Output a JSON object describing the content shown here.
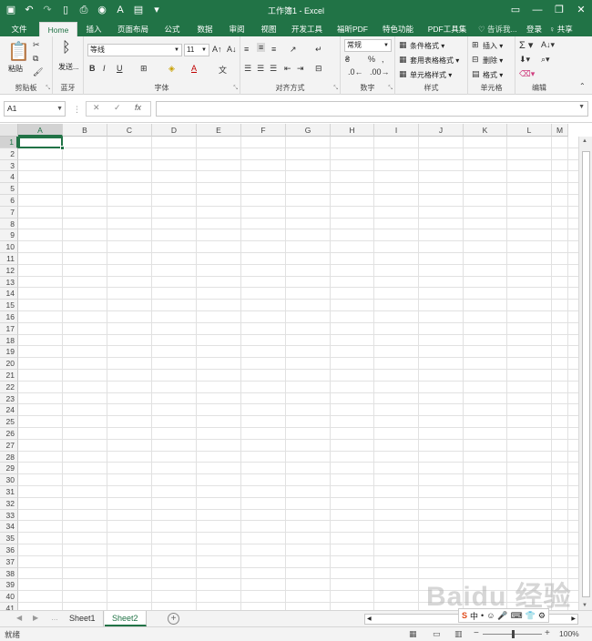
{
  "title_bar": {
    "title": "工作簿1 - Excel",
    "qat_icons": [
      "save-icon",
      "undo-icon",
      "redo-icon",
      "new-file-icon",
      "print-preview-icon",
      "camera-icon",
      "font-color-icon",
      "paste-dropdown-icon",
      "customize-qat-icon"
    ],
    "window_controls": [
      "ribbon-display-icon",
      "minimize-icon",
      "restore-icon",
      "close-icon"
    ]
  },
  "tabs": [
    "文件",
    "Home",
    "插入",
    "页面布局",
    "公式",
    "数据",
    "审阅",
    "视图",
    "开发工具",
    "福昕PDF",
    "特色功能",
    "PDF工具集"
  ],
  "active_tab": "Home",
  "tell_me": "♡ 告诉我...",
  "login": "登录",
  "share": "♀ 共享",
  "ribbon": {
    "clipboard": {
      "label": "剪贴板",
      "paste": "粘贴"
    },
    "bluetooth": {
      "label": "蓝牙",
      "send": "发送..."
    },
    "font": {
      "label": "字体",
      "font_name": "等线",
      "font_size": "11",
      "bold": "B",
      "italic": "I",
      "underline": "U"
    },
    "alignment": {
      "label": "对齐方式"
    },
    "number": {
      "label": "数字",
      "format": "常规",
      "percent": "%",
      "comma": ","
    },
    "styles": {
      "label": "样式",
      "conditional": "条件格式 ▾",
      "table": "套用表格格式 ▾",
      "cell_styles": "单元格样式 ▾"
    },
    "cells": {
      "label": "单元格",
      "insert": "插入 ▾",
      "delete": "删除 ▾",
      "format": "格式 ▾"
    },
    "editing": {
      "label": "编辑"
    }
  },
  "formula_bar": {
    "name_box": "A1",
    "fx": "fx",
    "value": ""
  },
  "grid": {
    "columns": [
      "A",
      "B",
      "C",
      "D",
      "E",
      "F",
      "G",
      "H",
      "I",
      "J",
      "K",
      "L",
      "M"
    ],
    "rows": [
      "1",
      "2",
      "3",
      "4",
      "5",
      "6",
      "7",
      "8",
      "9",
      "10",
      "11",
      "12",
      "13",
      "14",
      "15",
      "16",
      "17",
      "18",
      "19",
      "20",
      "21",
      "22",
      "23",
      "24",
      "25",
      "26",
      "27",
      "28",
      "29",
      "30",
      "31",
      "32",
      "33",
      "34",
      "35",
      "36",
      "37",
      "38",
      "39",
      "40",
      "41"
    ],
    "active_cell": "A1"
  },
  "sheets": [
    "Sheet1",
    "Sheet2"
  ],
  "active_sheet": "Sheet2",
  "status": {
    "ready": "就绪",
    "zoom": "100%",
    "zoom_value": 100
  },
  "watermark": "Baidu 经验",
  "ime": "中"
}
